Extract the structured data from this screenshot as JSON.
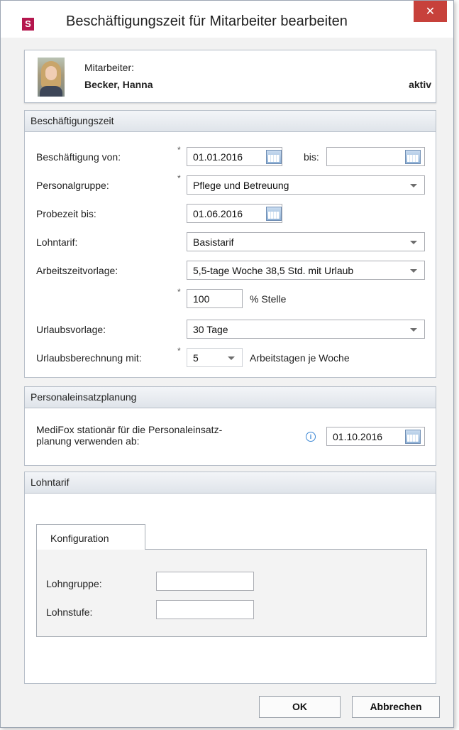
{
  "window": {
    "title": "Beschäftigungszeit für Mitarbeiter bearbeiten",
    "app_icon": "S",
    "close_glyph": "✕",
    "accent": "#b5174e"
  },
  "employee": {
    "caption": "Mitarbeiter:",
    "name": "Becker, Hanna",
    "status": "aktiv"
  },
  "employment": {
    "header": "Beschäftigungszeit",
    "from_label": "Beschäftigung von:",
    "from_value": "01.01.2016",
    "to_label": "bis:",
    "to_value": "",
    "group_label": "Personalgruppe:",
    "group_value": "Pflege und Betreuung",
    "probation_label": "Probezeit bis:",
    "probation_value": "01.06.2016",
    "wage_label": "Lohntarif:",
    "wage_value": "Basistarif",
    "worktime_label": "Arbeitszeitvorlage:",
    "worktime_value": "5,5-tage Woche 38,5 Std. mit Urlaub",
    "percent_value": "100",
    "percent_suffix": "% Stelle",
    "vacation_label": "Urlaubsvorlage:",
    "vacation_value": "30 Tage",
    "calc_label": "Urlaubsberechnung mit:",
    "calc_value": "5",
    "calc_suffix": "Arbeitstagen je Woche",
    "required_mark": "*"
  },
  "planning": {
    "header": "Personaleinsatzplanung",
    "label_line1": "MediFox stationär für die Personaleinsatz-",
    "label_line2": "planung verwenden ab:",
    "info_glyph": "i",
    "date_value": "01.10.2016"
  },
  "tariff": {
    "header": "Lohntarif",
    "tab_label": "Konfiguration",
    "group_label": "Lohngruppe:",
    "group_value": "",
    "level_label": "Lohnstufe:",
    "level_value": ""
  },
  "footer": {
    "ok_label": "OK",
    "cancel_label": "Abbrechen"
  }
}
